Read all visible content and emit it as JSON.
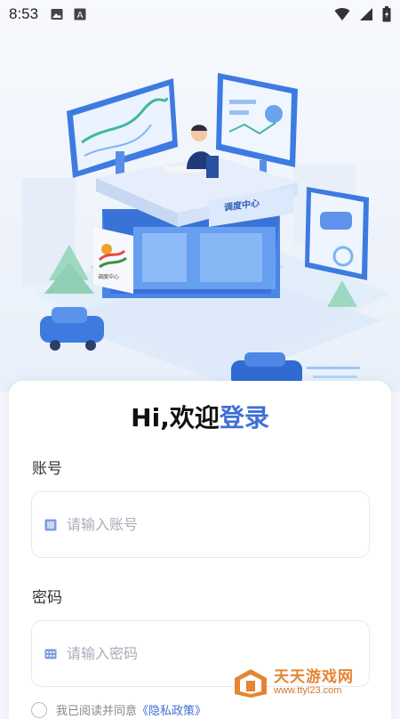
{
  "status_bar": {
    "time": "8:53",
    "icons": [
      "image-icon",
      "font-a-icon",
      "wifi-icon",
      "signal-icon",
      "battery-icon"
    ]
  },
  "hero": {
    "building_sign": "调度中心",
    "logo_caption": "调度中心"
  },
  "greeting": {
    "prefix": "Hi,欢迎",
    "accent": "登录"
  },
  "account": {
    "label": "账号",
    "placeholder": "请输入账号"
  },
  "password": {
    "label": "密码",
    "placeholder": "请输入密码"
  },
  "agreement": {
    "prefix": "我已阅读并同意",
    "link": "《隐私政策》"
  },
  "watermark": {
    "title": "天天游戏网",
    "url": "www.ttyl23.com"
  },
  "colors": {
    "accent": "#3f6fd6",
    "watermark": "#e2781e"
  }
}
